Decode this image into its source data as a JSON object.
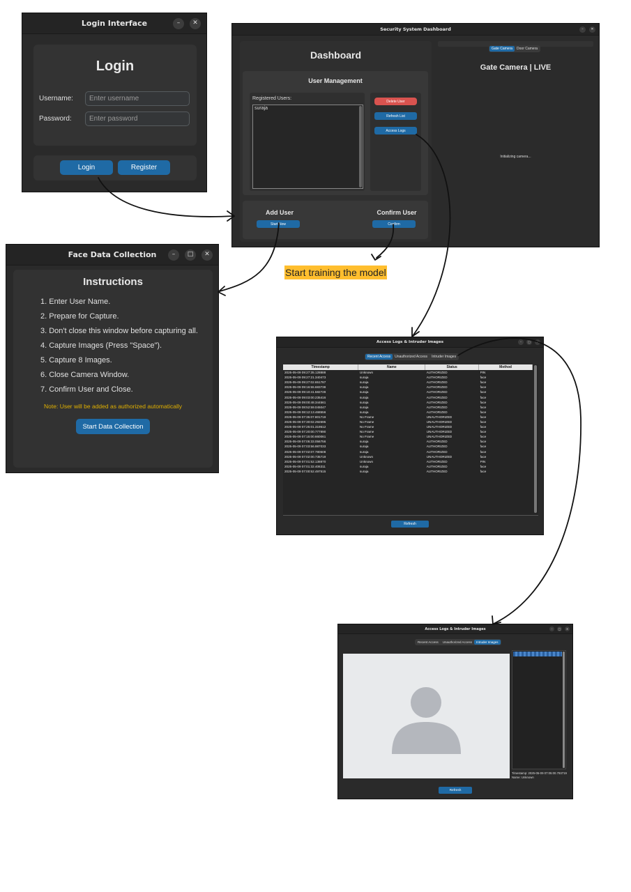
{
  "login_window": {
    "title": "Login Interface",
    "heading": "Login",
    "username_label": "Username:",
    "username_placeholder": "Enter username",
    "password_label": "Password:",
    "password_placeholder": "Enter password",
    "login_button": "Login",
    "register_button": "Register"
  },
  "dashboard_window": {
    "title": "Security System Dashboard",
    "heading": "Dashboard",
    "user_mgmt_title": "User Management",
    "registered_users_label": "Registered Users:",
    "registered_users": [
      "suraja"
    ],
    "delete_user": "Delete User",
    "refresh_list": "Refresh List",
    "access_logs": "Access Logs",
    "add_user_title": "Add User",
    "start_now": "Start Now",
    "confirm_user_title": "Confirm User",
    "confirm": "Confirm",
    "camera_tabs": [
      "Gate Camera",
      "Door Camera"
    ],
    "camera_title": "Gate Camera | LIVE",
    "camera_status": "Initializing camera..."
  },
  "face_window": {
    "title": "Face Data Collection",
    "heading": "Instructions",
    "steps": [
      "1. Enter User Name.",
      "2. Prepare for Capture.",
      "3. Don't close this window before capturing all.",
      "4. Capture Images (Press \"Space\").",
      "5. Capture 8 Images.",
      "6. Close Camera Window.",
      "7. Confirm User and Close."
    ],
    "note": "Note: User will be added as authorized automatically",
    "start_button": "Start Data Collection",
    "note_color": "#e0b000"
  },
  "annotation": {
    "text": "Start training the model",
    "color": "#ffbe2e"
  },
  "logs_window": {
    "title": "Access Logs & Intruder Images",
    "tabs": [
      "Recent Access",
      "Unauthorized Access",
      "Intruder Images"
    ],
    "columns": [
      "Timestamp",
      "Name",
      "Status",
      "Method"
    ],
    "rows": [
      [
        "2025-05-09 09:27:35.128888",
        "Unknown",
        "AUTHORIZED",
        "PIN"
      ],
      [
        "2025-05-09 09:27:21.340473",
        "suraja",
        "AUTHORIZED",
        "face"
      ],
      [
        "2025-05-09 09:27:02.651787",
        "suraja",
        "AUTHORIZED",
        "face"
      ],
      [
        "2025-05-09 09:16:55.683738",
        "suraja",
        "AUTHORIZED",
        "face"
      ],
      [
        "2025-05-09 09:10:41.582728",
        "suraja",
        "AUTHORIZED",
        "face"
      ],
      [
        "2025-05-09 09:03:00.235416",
        "suraja",
        "AUTHORIZED",
        "face"
      ],
      [
        "2025-05-09 09:00:48.344561",
        "suraja",
        "AUTHORIZED",
        "face"
      ],
      [
        "2025-05-09 08:52:59.045047",
        "suraja",
        "AUTHORIZED",
        "face"
      ],
      [
        "2025-05-09 08:12:13.468556",
        "suraja",
        "AUTHORIZED",
        "face"
      ],
      [
        "2025-05-09 07:35:07.801719",
        "No Frame",
        "UNAUTHORIZED",
        "face"
      ],
      [
        "2025-05-09 07:30:02.292695",
        "No Frame",
        "UNAUTHORIZED",
        "face"
      ],
      [
        "2025-05-09 07:25:01.319512",
        "No Frame",
        "UNAUTHORIZED",
        "face"
      ],
      [
        "2025-05-09 07:20:00.777890",
        "No Frame",
        "UNAUTHORIZED",
        "face"
      ],
      [
        "2025-05-09 07:15:00.660061",
        "No Frame",
        "UNAUTHORIZED",
        "face"
      ],
      [
        "2025-05-09 07:05:33.056756",
        "suraja",
        "AUTHORIZED",
        "face"
      ],
      [
        "2025-05-09 07:03:56.987033",
        "suraja",
        "AUTHORIZED",
        "face"
      ],
      [
        "2025-05-09 07:02:07.780508",
        "suraja",
        "AUTHORIZED",
        "face"
      ],
      [
        "2025-05-09 07:02:00.735719",
        "Unknown",
        "UNAUTHORIZED",
        "face"
      ],
      [
        "2025-05-09 07:01:52.138870",
        "Unknown",
        "AUTHORIZED",
        "PIN"
      ],
      [
        "2025-05-09 07:01:32.406311",
        "suraja",
        "AUTHORIZED",
        "face"
      ],
      [
        "2025-05-09 07:00:52.497515",
        "suraja",
        "AUTHORIZED",
        "face"
      ]
    ],
    "refresh": "Refresh"
  },
  "intruder_window": {
    "title": "Access Logs & Intruder Images",
    "tabs": [
      "Recent Access",
      "Unauthorized Access",
      "Intruder Images"
    ],
    "caption_line1": "Timestamp: 2025-05-09 07:05:00.793719",
    "caption_line2": "Name: Unknown",
    "refresh": "Refresh"
  }
}
